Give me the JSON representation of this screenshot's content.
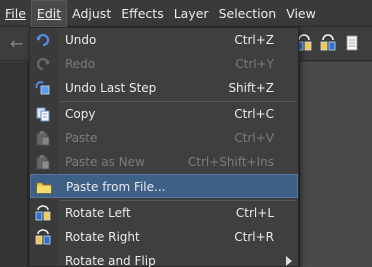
{
  "menubar": {
    "items": [
      {
        "label": "File"
      },
      {
        "label": "Edit"
      },
      {
        "label": "Adjust"
      },
      {
        "label": "Effects"
      },
      {
        "label": "Layer"
      },
      {
        "label": "Selection"
      },
      {
        "label": "View"
      }
    ],
    "active": "Edit"
  },
  "edit_menu": {
    "items": [
      {
        "label": "Undo",
        "shortcut": "Ctrl+Z",
        "enabled": true,
        "icon": "undo-icon"
      },
      {
        "label": "Redo",
        "shortcut": "Ctrl+Y",
        "enabled": false,
        "icon": "redo-icon"
      },
      {
        "label": "Undo Last Step",
        "shortcut": "Shift+Z",
        "enabled": true,
        "icon": "undo-last-step-icon"
      },
      {
        "label": "Copy",
        "shortcut": "Ctrl+C",
        "enabled": true,
        "icon": "copy-icon"
      },
      {
        "label": "Paste",
        "shortcut": "Ctrl+V",
        "enabled": false,
        "icon": "paste-icon"
      },
      {
        "label": "Paste as New",
        "shortcut": "Ctrl+Shift+Ins",
        "enabled": false,
        "icon": "paste-as-new-icon"
      },
      {
        "label": "Paste from File...",
        "shortcut": "",
        "enabled": true,
        "highlighted": true,
        "icon": "paste-from-file-icon"
      },
      {
        "label": "Rotate Left",
        "shortcut": "Ctrl+L",
        "enabled": true,
        "icon": "rotate-left-icon"
      },
      {
        "label": "Rotate Right",
        "shortcut": "Ctrl+R",
        "enabled": true,
        "icon": "rotate-right-icon"
      },
      {
        "label": "Rotate and Flip",
        "shortcut": "",
        "enabled": true,
        "submenu": true
      }
    ]
  },
  "colors": {
    "highlight": "#3e5f86",
    "menu_bg": "#3f3f3f",
    "disabled_text": "#7c7c7c"
  }
}
